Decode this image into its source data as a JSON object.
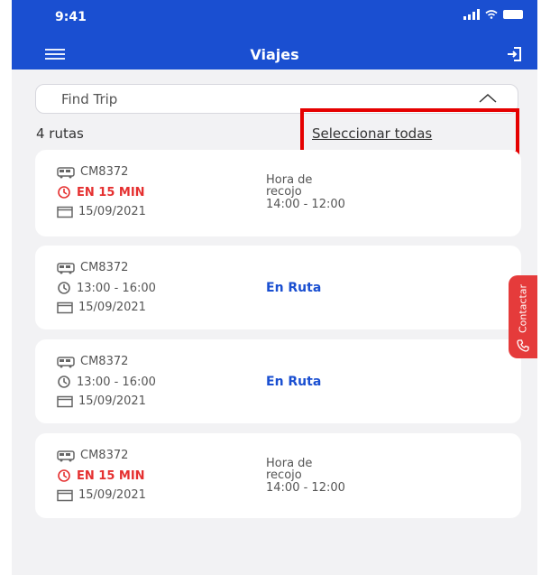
{
  "status_bar": {
    "time": "9:41"
  },
  "header": {
    "title": "Viajes"
  },
  "search": {
    "placeholder": "Find Trip"
  },
  "summary": {
    "count": "4 rutas",
    "select_all": "Seleccionar todas"
  },
  "trips": [
    {
      "code": "CM8372",
      "time": "EN 15 MIN",
      "date": "15/09/2021",
      "pickup_label": "Hora de recojo",
      "pickup_time": "14:00 - 12:00",
      "status": ""
    },
    {
      "code": "CM8372",
      "time": "13:00 - 16:00",
      "date": "15/09/2021",
      "pickup_label": "",
      "pickup_time": "",
      "status": "En Ruta"
    },
    {
      "code": "CM8372",
      "time": "13:00 - 16:00",
      "date": "15/09/2021",
      "pickup_label": "",
      "pickup_time": "",
      "status": "En Ruta"
    },
    {
      "code": "CM8372",
      "time": "EN 15 MIN",
      "date": "15/09/2021",
      "pickup_label": "Hora de recojo",
      "pickup_time": "14:00 - 12:00",
      "status": ""
    }
  ],
  "contact": {
    "label": "Contactar"
  },
  "colors": {
    "primary": "#1a4fd1",
    "urgent": "#e53030",
    "highlight": "#e50000",
    "contact": "#e53b3b"
  },
  "icons": [
    "hamburger-icon",
    "logout-icon",
    "chevron-up-icon",
    "bus-icon",
    "clock-icon",
    "calendar-icon",
    "phone-icon"
  ]
}
